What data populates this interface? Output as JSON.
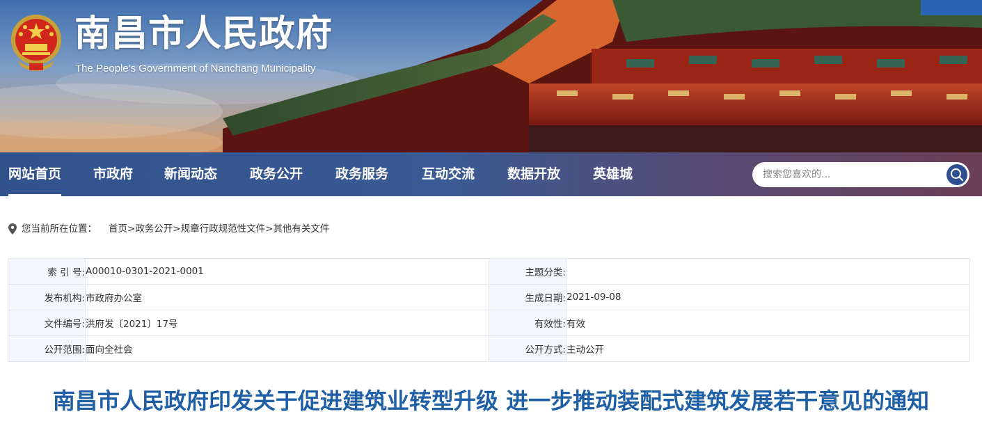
{
  "header": {
    "site_title": "南昌市人民政府",
    "site_subtitle": "The People's Government of Nanchang Municipality",
    "emblem_icon": "national-emblem-icon"
  },
  "nav": {
    "items": [
      {
        "label": "网站首页",
        "active": true
      },
      {
        "label": "市政府",
        "active": false
      },
      {
        "label": "新闻动态",
        "active": false
      },
      {
        "label": "政务公开",
        "active": false
      },
      {
        "label": "政务服务",
        "active": false
      },
      {
        "label": "互动交流",
        "active": false
      },
      {
        "label": "数据开放",
        "active": false
      },
      {
        "label": "英雄城",
        "active": false
      }
    ],
    "search_placeholder": "搜索您喜欢的...",
    "search_icon": "search-icon"
  },
  "breadcrumb": {
    "icon": "location-pin-icon",
    "label": "您当前所在位置：",
    "links": [
      "首页",
      "政务公开",
      "规章行政规范性文件",
      "其他有关文件"
    ],
    "separator": ">"
  },
  "info": {
    "rows": [
      {
        "k1": "索  引  号:",
        "v1": "A00010-0301-2021-0001",
        "k2": "主题分类:",
        "v2": ""
      },
      {
        "k1": "发布机构:",
        "v1": "市政府办公室",
        "k2": "生成日期:",
        "v2": "2021-09-08"
      },
      {
        "k1": "文件编号:",
        "v1": "洪府发〔2021〕17号",
        "k2": "有效性:",
        "v2": "有效"
      },
      {
        "k1": "公开范围:",
        "v1": "面向全社会",
        "k2": "公开方式:",
        "v2": "主动公开"
      }
    ]
  },
  "article": {
    "title": "南昌市人民政府印发关于促进建筑业转型升级 进一步推动装配式建筑发展若干意见的通知"
  },
  "colors": {
    "nav_bg": "#31528c",
    "title_blue": "#1f5fa6",
    "table_key_bg": "#f3f7fb",
    "table_border": "#dfe6ee"
  }
}
